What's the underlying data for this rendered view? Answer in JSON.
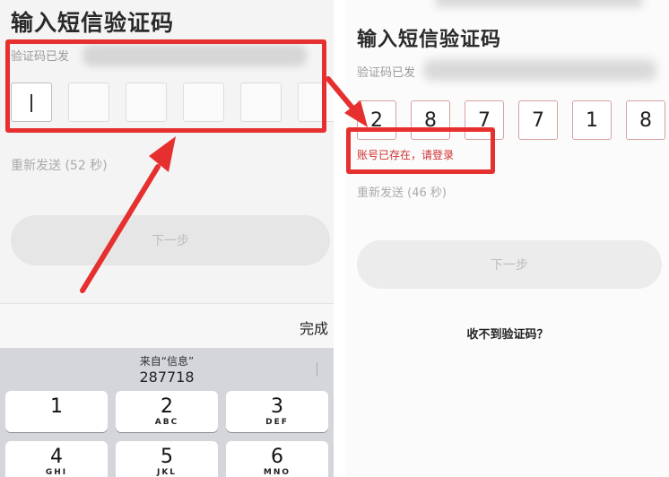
{
  "left": {
    "title": "输入短信验证码",
    "subtitle": "验证码已发",
    "resend": "重新发送 (52 秒)",
    "next": "下一步",
    "done": "完成",
    "suggestion_source": "来自“信息”",
    "suggestion_code": "287718",
    "keys": [
      {
        "num": "1",
        "sub": ""
      },
      {
        "num": "2",
        "sub": "ABC"
      },
      {
        "num": "3",
        "sub": "DEF"
      },
      {
        "num": "4",
        "sub": "GHI"
      },
      {
        "num": "5",
        "sub": "JKL"
      },
      {
        "num": "6",
        "sub": "MNO"
      }
    ]
  },
  "right": {
    "title": "输入短信验证码",
    "subtitle": "验证码已发",
    "digits": [
      "2",
      "8",
      "7",
      "7",
      "1",
      "8"
    ],
    "error": "账号已存在，请登录",
    "resend": "重新发送 (46 秒)",
    "next": "下一步",
    "help": "收不到验证码？"
  },
  "colors": {
    "annotation_red": "#e63030",
    "error_red": "#d0302e",
    "box_border_filled": "#d8a0a0"
  }
}
